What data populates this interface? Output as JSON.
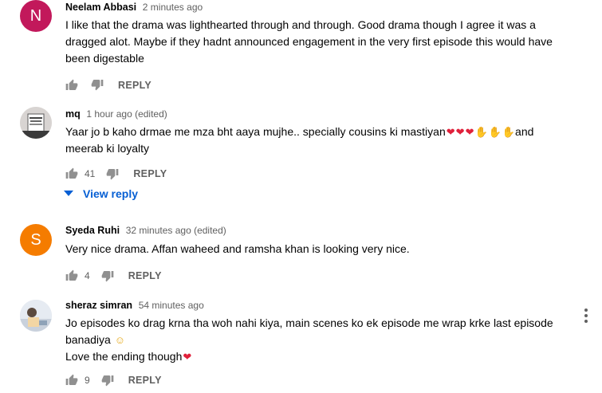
{
  "comments": [
    {
      "author": "Neelam Abbasi",
      "time": "2 minutes ago",
      "avatar_letter": "N",
      "avatar_color": "#c2185b",
      "text": "I like that the drama was lighthearted through and through. Good drama though I agree it was a dragged alot. Maybe if they hadnt announced engagement in the very first episode this would have been digestable",
      "likes": "",
      "reply_label": "REPLY"
    },
    {
      "author": "mq",
      "time": "1 hour ago (edited)",
      "text_main": "Yaar jo b kaho drmae me mza bht aaya mujhe.. specially cousins ki mastiyan",
      "text_tail": "and meerab ki loyalty",
      "likes": "41",
      "reply_label": "REPLY",
      "view_reply_label": "View reply"
    },
    {
      "author": "Syeda Ruhi",
      "time": "32 minutes ago (edited)",
      "avatar_letter": "S",
      "avatar_color": "#f57c00",
      "text": "Very nice drama. Affan waheed and ramsha khan is looking very nice.",
      "likes": "4",
      "reply_label": "REPLY"
    },
    {
      "author": "sheraz simran",
      "time": "54 minutes ago",
      "text_line1": "Jo episodes ko drag krna tha woh nahi kiya, main scenes ko ek episode me wrap krke last episode banadiya",
      "text_line2": "Love the ending though",
      "likes": "9",
      "reply_label": "REPLY"
    }
  ],
  "icons": {
    "like": "thumb-up-icon",
    "dislike": "thumb-down-icon",
    "menu": "more-vert-icon",
    "view_reply": "chevron-down-icon",
    "heart": "red-heart-emoji",
    "clap": "clapping-hands-emoji",
    "smile": "smiling-face-emoji"
  },
  "colors": {
    "link_blue": "#065fd4",
    "secondary_text": "#606060",
    "heart_red": "#e0203a"
  }
}
